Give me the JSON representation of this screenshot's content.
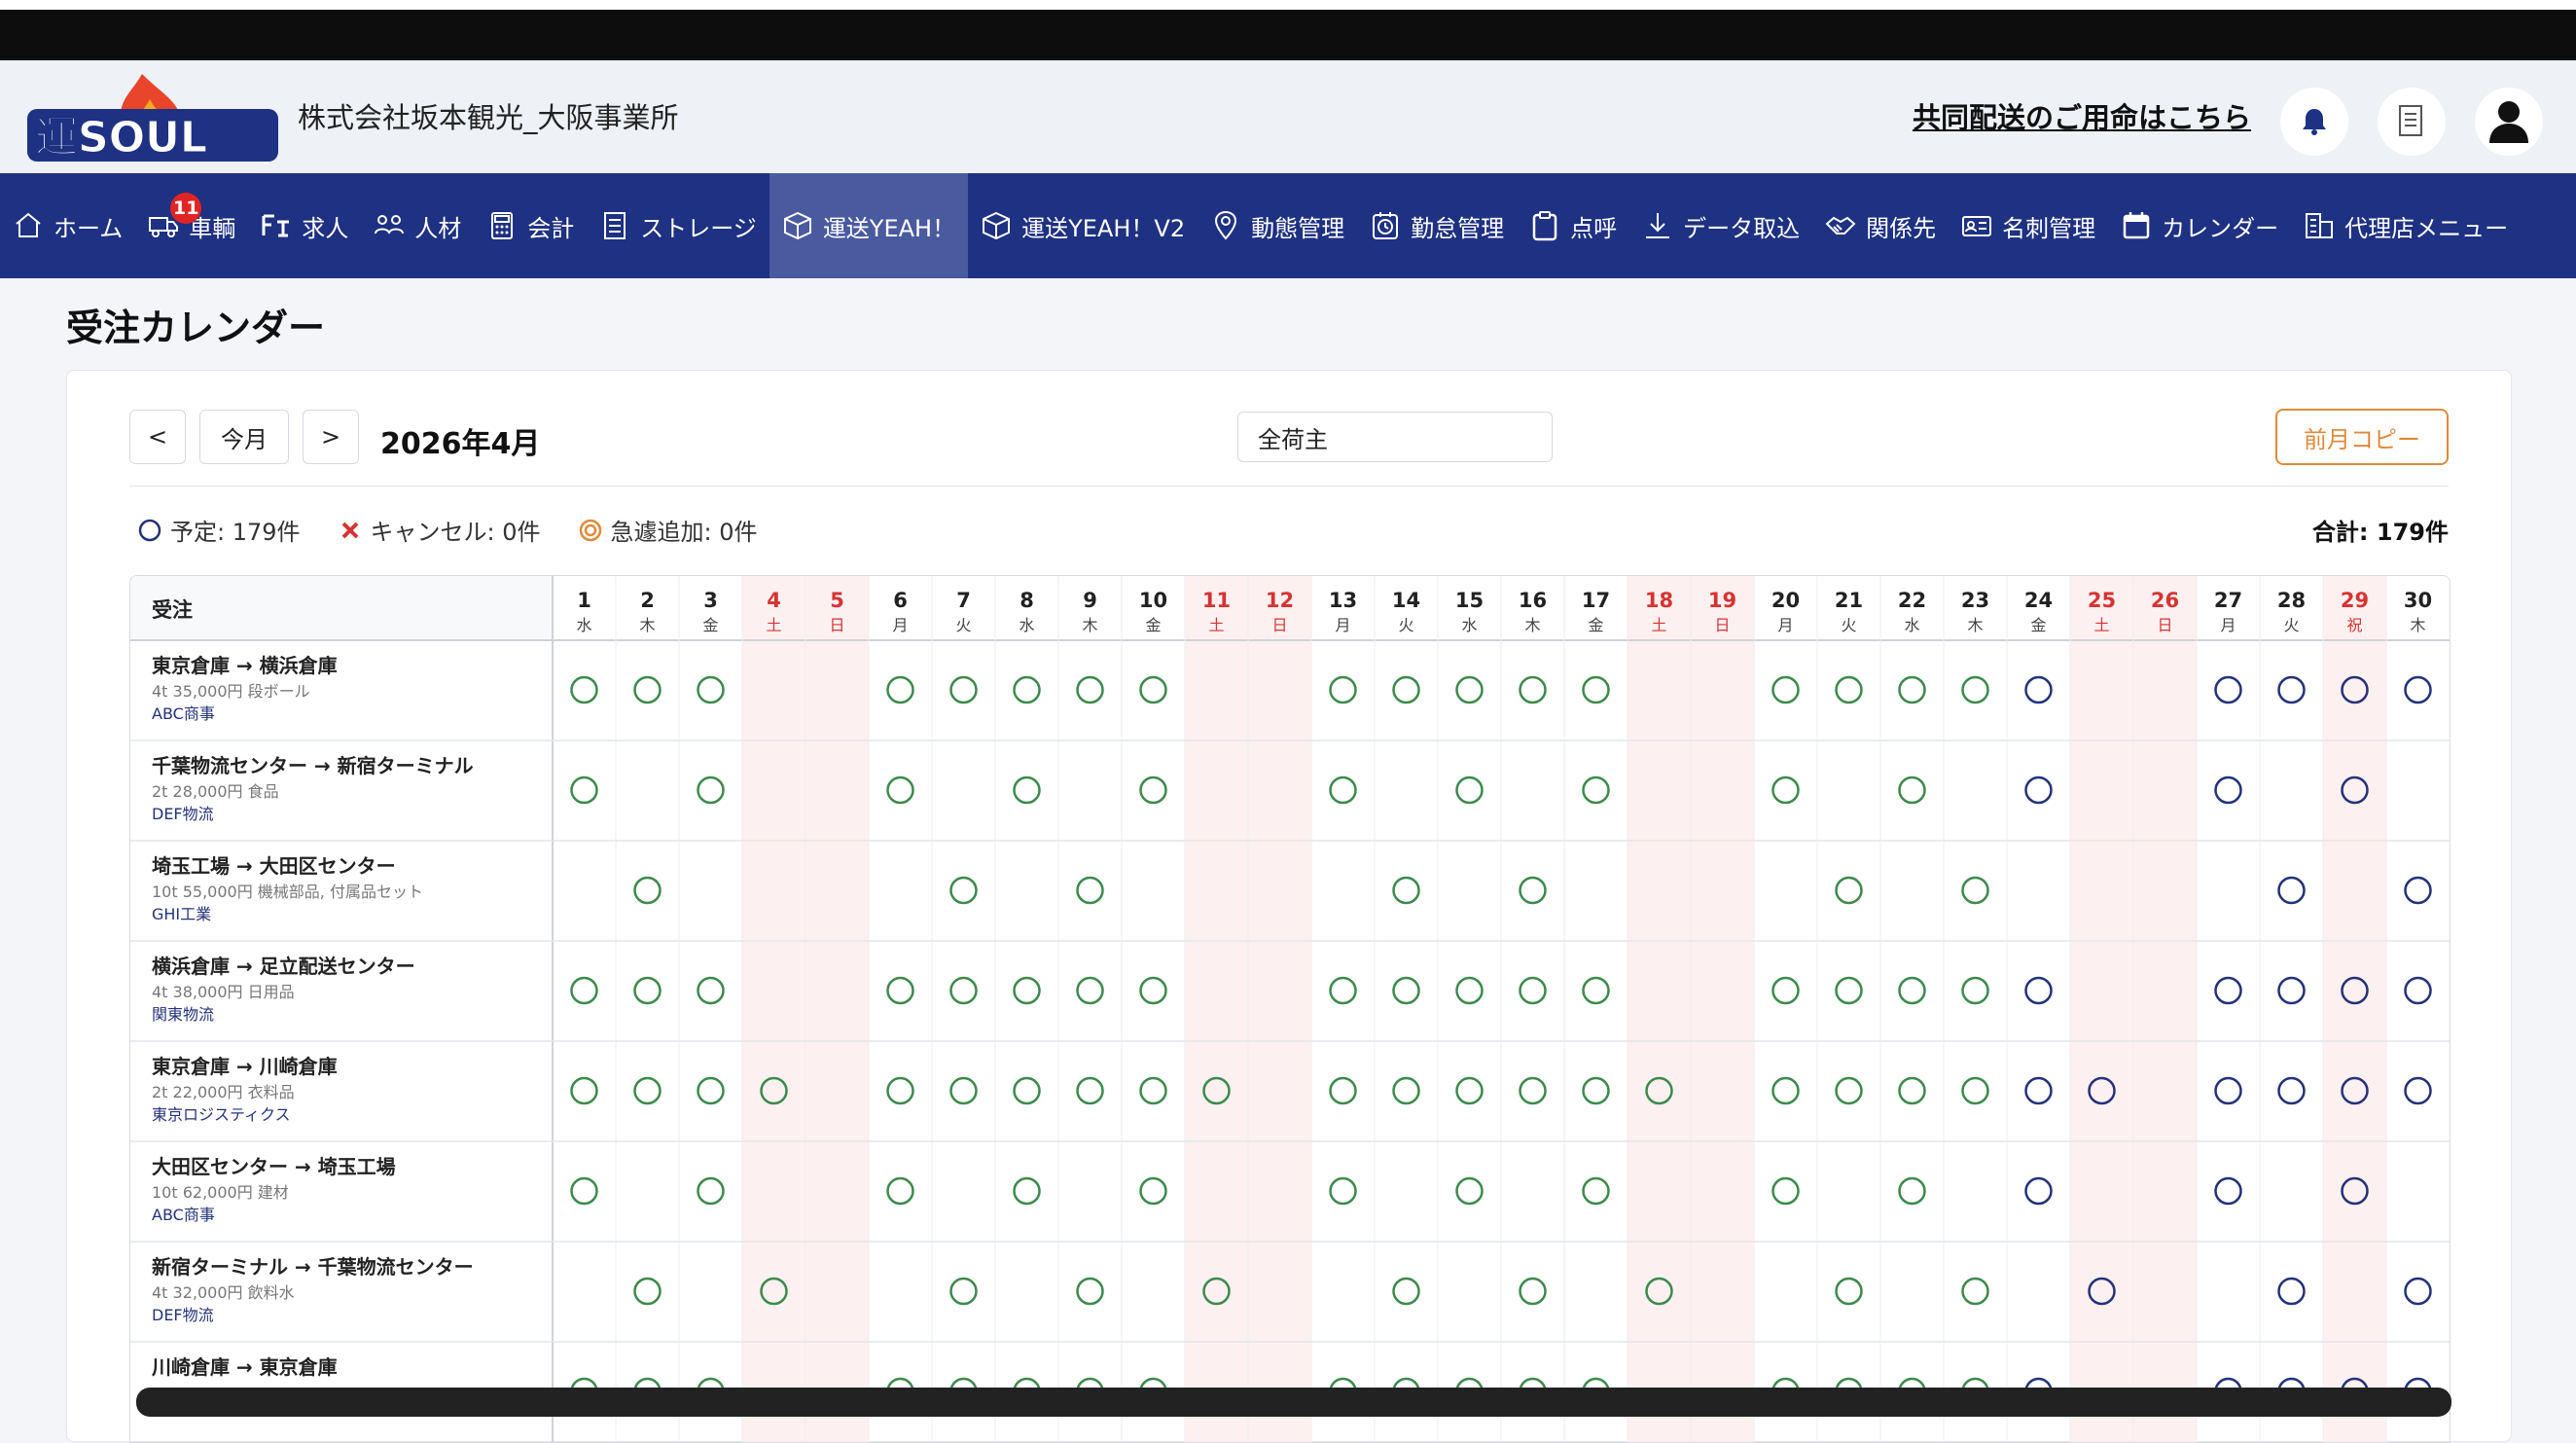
{
  "header": {
    "company": "株式会社坂本観光_大阪事業所",
    "shared_link": "共同配送のご用命はこちら"
  },
  "nav": [
    {
      "label": "ホーム",
      "icon": "home-icon"
    },
    {
      "label": "車輌",
      "icon": "truck-icon",
      "badge": "11"
    },
    {
      "label": "求人",
      "icon": "job-icon"
    },
    {
      "label": "人材",
      "icon": "people-icon"
    },
    {
      "label": "会計",
      "icon": "calculator-icon"
    },
    {
      "label": "ストレージ",
      "icon": "document-icon"
    },
    {
      "label": "運送YEAH！",
      "icon": "box-icon",
      "active": true
    },
    {
      "label": "運送YEAH！V2",
      "icon": "box-icon"
    },
    {
      "label": "動態管理",
      "icon": "location-pin-icon"
    },
    {
      "label": "勤怠管理",
      "icon": "clock-icon"
    },
    {
      "label": "点呼",
      "icon": "clipboard-icon"
    },
    {
      "label": "データ取込",
      "icon": "download-icon"
    },
    {
      "label": "関係先",
      "icon": "handshake-icon"
    },
    {
      "label": "名刺管理",
      "icon": "id-card-icon"
    },
    {
      "label": "カレンダー",
      "icon": "calendar-icon"
    },
    {
      "label": "代理店メニュー",
      "icon": "building-icon"
    }
  ],
  "page_title": "受注カレンダー",
  "controls": {
    "prev": "<",
    "today": "今月",
    "next": ">",
    "month": "2026年4月",
    "shipper_value": "全荷主",
    "copy_button": "前月コピー"
  },
  "legend": {
    "planned": "予定: 179件",
    "cancel": "キャンセル: 0件",
    "urgent": "急遽追加: 0件",
    "total": "合計: 179件"
  },
  "colors": {
    "nav_bg": "#1e3182",
    "planned_past": "#3d8a4c",
    "planned_future": "#24327a",
    "cancel": "#d63333",
    "urgent": "#e08a3a",
    "holiday_bg": "#fdf0f0",
    "holiday_text": "#d63333"
  },
  "calendar": {
    "header_label": "受注",
    "days": [
      {
        "d": "1",
        "w": "水"
      },
      {
        "d": "2",
        "w": "木"
      },
      {
        "d": "3",
        "w": "金"
      },
      {
        "d": "4",
        "w": "土"
      },
      {
        "d": "5",
        "w": "日"
      },
      {
        "d": "6",
        "w": "月"
      },
      {
        "d": "7",
        "w": "火"
      },
      {
        "d": "8",
        "w": "水"
      },
      {
        "d": "9",
        "w": "木"
      },
      {
        "d": "10",
        "w": "金"
      },
      {
        "d": "11",
        "w": "土"
      },
      {
        "d": "12",
        "w": "日"
      },
      {
        "d": "13",
        "w": "月"
      },
      {
        "d": "14",
        "w": "火"
      },
      {
        "d": "15",
        "w": "水"
      },
      {
        "d": "16",
        "w": "木"
      },
      {
        "d": "17",
        "w": "金"
      },
      {
        "d": "18",
        "w": "土"
      },
      {
        "d": "19",
        "w": "日"
      },
      {
        "d": "20",
        "w": "月"
      },
      {
        "d": "21",
        "w": "火"
      },
      {
        "d": "22",
        "w": "水"
      },
      {
        "d": "23",
        "w": "木"
      },
      {
        "d": "24",
        "w": "金"
      },
      {
        "d": "25",
        "w": "土"
      },
      {
        "d": "26",
        "w": "日"
      },
      {
        "d": "27",
        "w": "月"
      },
      {
        "d": "28",
        "w": "火"
      },
      {
        "d": "29",
        "w": "祝"
      },
      {
        "d": "30",
        "w": "木"
      }
    ],
    "holidays": [
      4,
      5,
      11,
      12,
      18,
      19,
      25,
      26,
      29
    ],
    "today_day": 23,
    "orders": [
      {
        "route": "東京倉庫 → 横浜倉庫",
        "detail": "4t  35,000円  段ボール",
        "shipper": "ABC商事",
        "days": [
          1,
          2,
          3,
          6,
          7,
          8,
          9,
          10,
          13,
          14,
          15,
          16,
          17,
          20,
          21,
          22,
          23,
          24,
          27,
          28,
          29,
          30
        ]
      },
      {
        "route": "千葉物流センター → 新宿ターミナル",
        "detail": "2t  28,000円  食品",
        "shipper": "DEF物流",
        "days": [
          1,
          3,
          6,
          8,
          10,
          13,
          15,
          17,
          20,
          22,
          24,
          27,
          29
        ]
      },
      {
        "route": "埼玉工場 → 大田区センター",
        "detail": "10t  55,000円  機械部品, 付属品セット",
        "shipper": "GHI工業",
        "days": [
          2,
          7,
          9,
          14,
          16,
          21,
          23,
          28,
          30
        ]
      },
      {
        "route": "横浜倉庫 → 足立配送センター",
        "detail": "4t  38,000円  日用品",
        "shipper": "関東物流",
        "days": [
          1,
          2,
          3,
          6,
          7,
          8,
          9,
          10,
          13,
          14,
          15,
          16,
          17,
          20,
          21,
          22,
          23,
          24,
          27,
          28,
          29,
          30
        ]
      },
      {
        "route": "東京倉庫 → 川崎倉庫",
        "detail": "2t  22,000円  衣料品",
        "shipper": "東京ロジスティクス",
        "days": [
          1,
          2,
          3,
          4,
          6,
          7,
          8,
          9,
          10,
          11,
          13,
          14,
          15,
          16,
          17,
          18,
          20,
          21,
          22,
          23,
          24,
          25,
          27,
          28,
          29,
          30
        ]
      },
      {
        "route": "大田区センター → 埼玉工場",
        "detail": "10t  62,000円  建材",
        "shipper": "ABC商事",
        "days": [
          1,
          3,
          6,
          8,
          10,
          13,
          15,
          17,
          20,
          22,
          24,
          27,
          29
        ]
      },
      {
        "route": "新宿ターミナル → 千葉物流センター",
        "detail": "4t  32,000円  飲料水",
        "shipper": "DEF物流",
        "days": [
          2,
          4,
          7,
          9,
          11,
          14,
          16,
          18,
          21,
          23,
          25,
          28,
          30
        ]
      },
      {
        "route": "川崎倉庫 → 東京倉庫",
        "detail": "",
        "shipper": "",
        "days": [
          1,
          2,
          3,
          6,
          7,
          8,
          9,
          10,
          13,
          14,
          15,
          16,
          17,
          20,
          21,
          22,
          23,
          24,
          27,
          28,
          29,
          30
        ]
      }
    ]
  }
}
